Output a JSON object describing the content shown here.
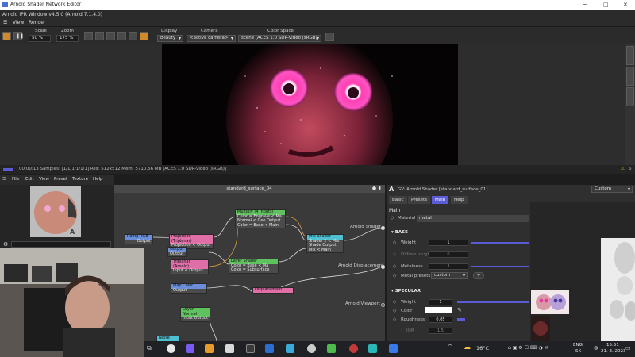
{
  "window": {
    "title": "Arnold Shader Network Editor",
    "ipr_title": "Arnold IPR Window v4.5.0 (Arnold 7.1.4.0)"
  },
  "menu": {
    "view": "View",
    "render": "Render"
  },
  "toolbar": {
    "scale_label": "Scale",
    "scale_value": "50 %",
    "zoom_label": "Zoom",
    "zoom_value": "175 %",
    "display_label": "Display",
    "display_value": "beauty",
    "camera_label": "Camera",
    "camera_value": "<active camera>",
    "colorspace_label": "Color Space",
    "colorspace_value": "scene (ACES 1.0 SDR-video (sRGB)"
  },
  "status": {
    "text": "00:00:13  Samples: [1/1/1/1/1/1]  Res: 512x512  Mem: 5710.56 MB  [ACES 1.0 SDR-video (sRGB)]",
    "warnings": "6"
  },
  "editor_menu": {
    "file": "File",
    "edit": "Edit",
    "view": "View",
    "preset": "Preset",
    "texture": "Texture",
    "help": "Help"
  },
  "graph": {
    "title": "standard_surface_04",
    "ports": {
      "shader": "Arnold Shader",
      "displacement": "Arnold Displacement",
      "viewport": "Arnold Viewport"
    },
    "nodes": [
      {
        "header": "Multiply (4 Inputs)",
        "rows": [
          "Color = Engrave < Ma",
          "Normal < Geo Output",
          "Color = Base < Main"
        ]
      },
      {
        "header": "Ramp RGB",
        "rows": [
          "Output"
        ]
      },
      {
        "header": "Projection (Triplanar)",
        "rows": [
          "Projection < Output"
        ]
      },
      {
        "header": "Output",
        "rows": [
          "Output"
        ]
      },
      {
        "header": "Triplanar (Arnold)",
        "rows": [
          "Input < Output"
        ]
      },
      {
        "header": "Layer Shader",
        "rows": [
          "Color = Base < Ma",
          "Color = Subsurface"
        ]
      },
      {
        "header": "Mix Shader",
        "rows": [
          "Shader 2 < Mix",
          "Shade Output",
          "Mix < Main"
        ]
      },
      {
        "header": "Map Color",
        "rows": [
          "Output"
        ]
      },
      {
        "header": "Displacement",
        "rows": []
      },
      {
        "header": "Layer Normal",
        "rows": [
          "Input Output"
        ]
      },
      {
        "header": "Noise",
        "rows": []
      }
    ]
  },
  "shader": {
    "header": "GV: Arnold Shader [standard_surface_01]",
    "preset_value": "Custom",
    "tabs": [
      "Basic",
      "Presets",
      "Main",
      "Help"
    ],
    "main_label": "Main",
    "material_label": "Material",
    "material_value": "metal",
    "base_section": "BASE",
    "weight_label": "Weight",
    "weight_value": "1",
    "diffuse_roughness_label": "Diffuse roughness",
    "diffuse_roughness_value": "0",
    "metalness_label": "Metalness",
    "metalness_value": "1",
    "metal_presets_label": "Metal presets",
    "metal_presets_value": "custom",
    "specular_section": "SPECULAR",
    "spec_weight_label": "Weight",
    "spec_weight_value": "1",
    "spec_color_label": "Color",
    "spec_roughness_label": "Roughness",
    "spec_roughness_value": "0.05",
    "ior_label": "IOR",
    "ior_value": "1.5"
  },
  "taskbar": {
    "temp": "16°C",
    "lang1": "ENG",
    "lang2": "SK",
    "time": "15:51",
    "date": "21. 3. 2023"
  },
  "colors": {
    "accent": "#5b5bd6",
    "node_green": "#5ec25e",
    "node_pink": "#e06fa8",
    "node_blue": "#6a8fd8",
    "node_cyan": "#4fc0d0"
  }
}
